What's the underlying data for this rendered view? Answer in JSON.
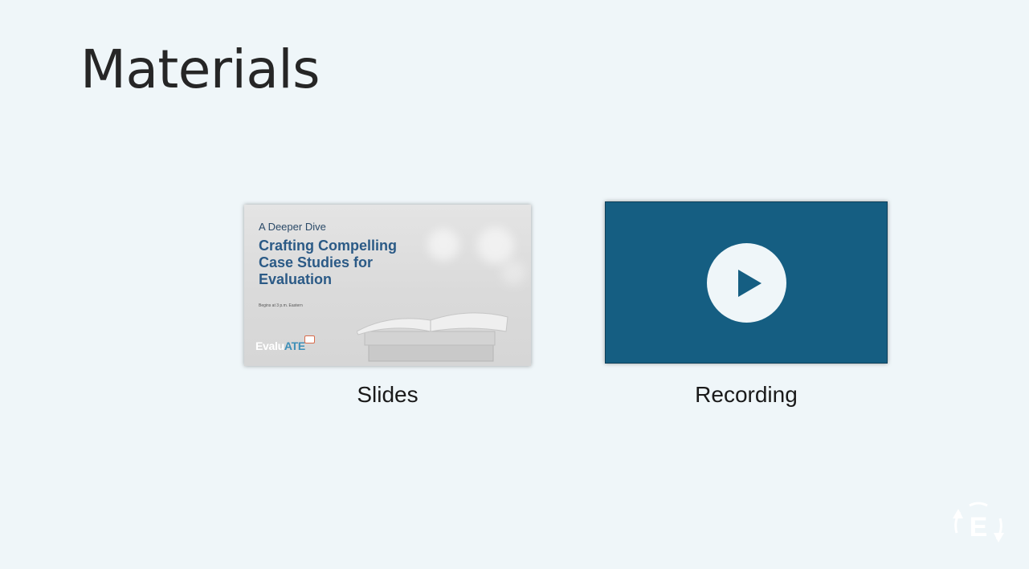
{
  "page": {
    "title": "Materials"
  },
  "materials": [
    {
      "label": "Slides",
      "thumbnail": {
        "kicker": "A Deeper Dive",
        "title": "Crafting Compelling Case Studies for Evaluation",
        "subtitle": "Begins at 3 p.m. Eastern",
        "logo_text": "Evalu",
        "logo_accent": "ATE"
      }
    },
    {
      "label": "Recording",
      "thumbnail": {
        "icon": "play-icon",
        "bg_color": "#155e82"
      }
    }
  ],
  "corner_logo": {
    "letter": "E",
    "icon": "evaluate-logo-icon"
  },
  "colors": {
    "background": "#eff6f9",
    "recording_bg": "#155e82",
    "title_text": "#262626"
  }
}
